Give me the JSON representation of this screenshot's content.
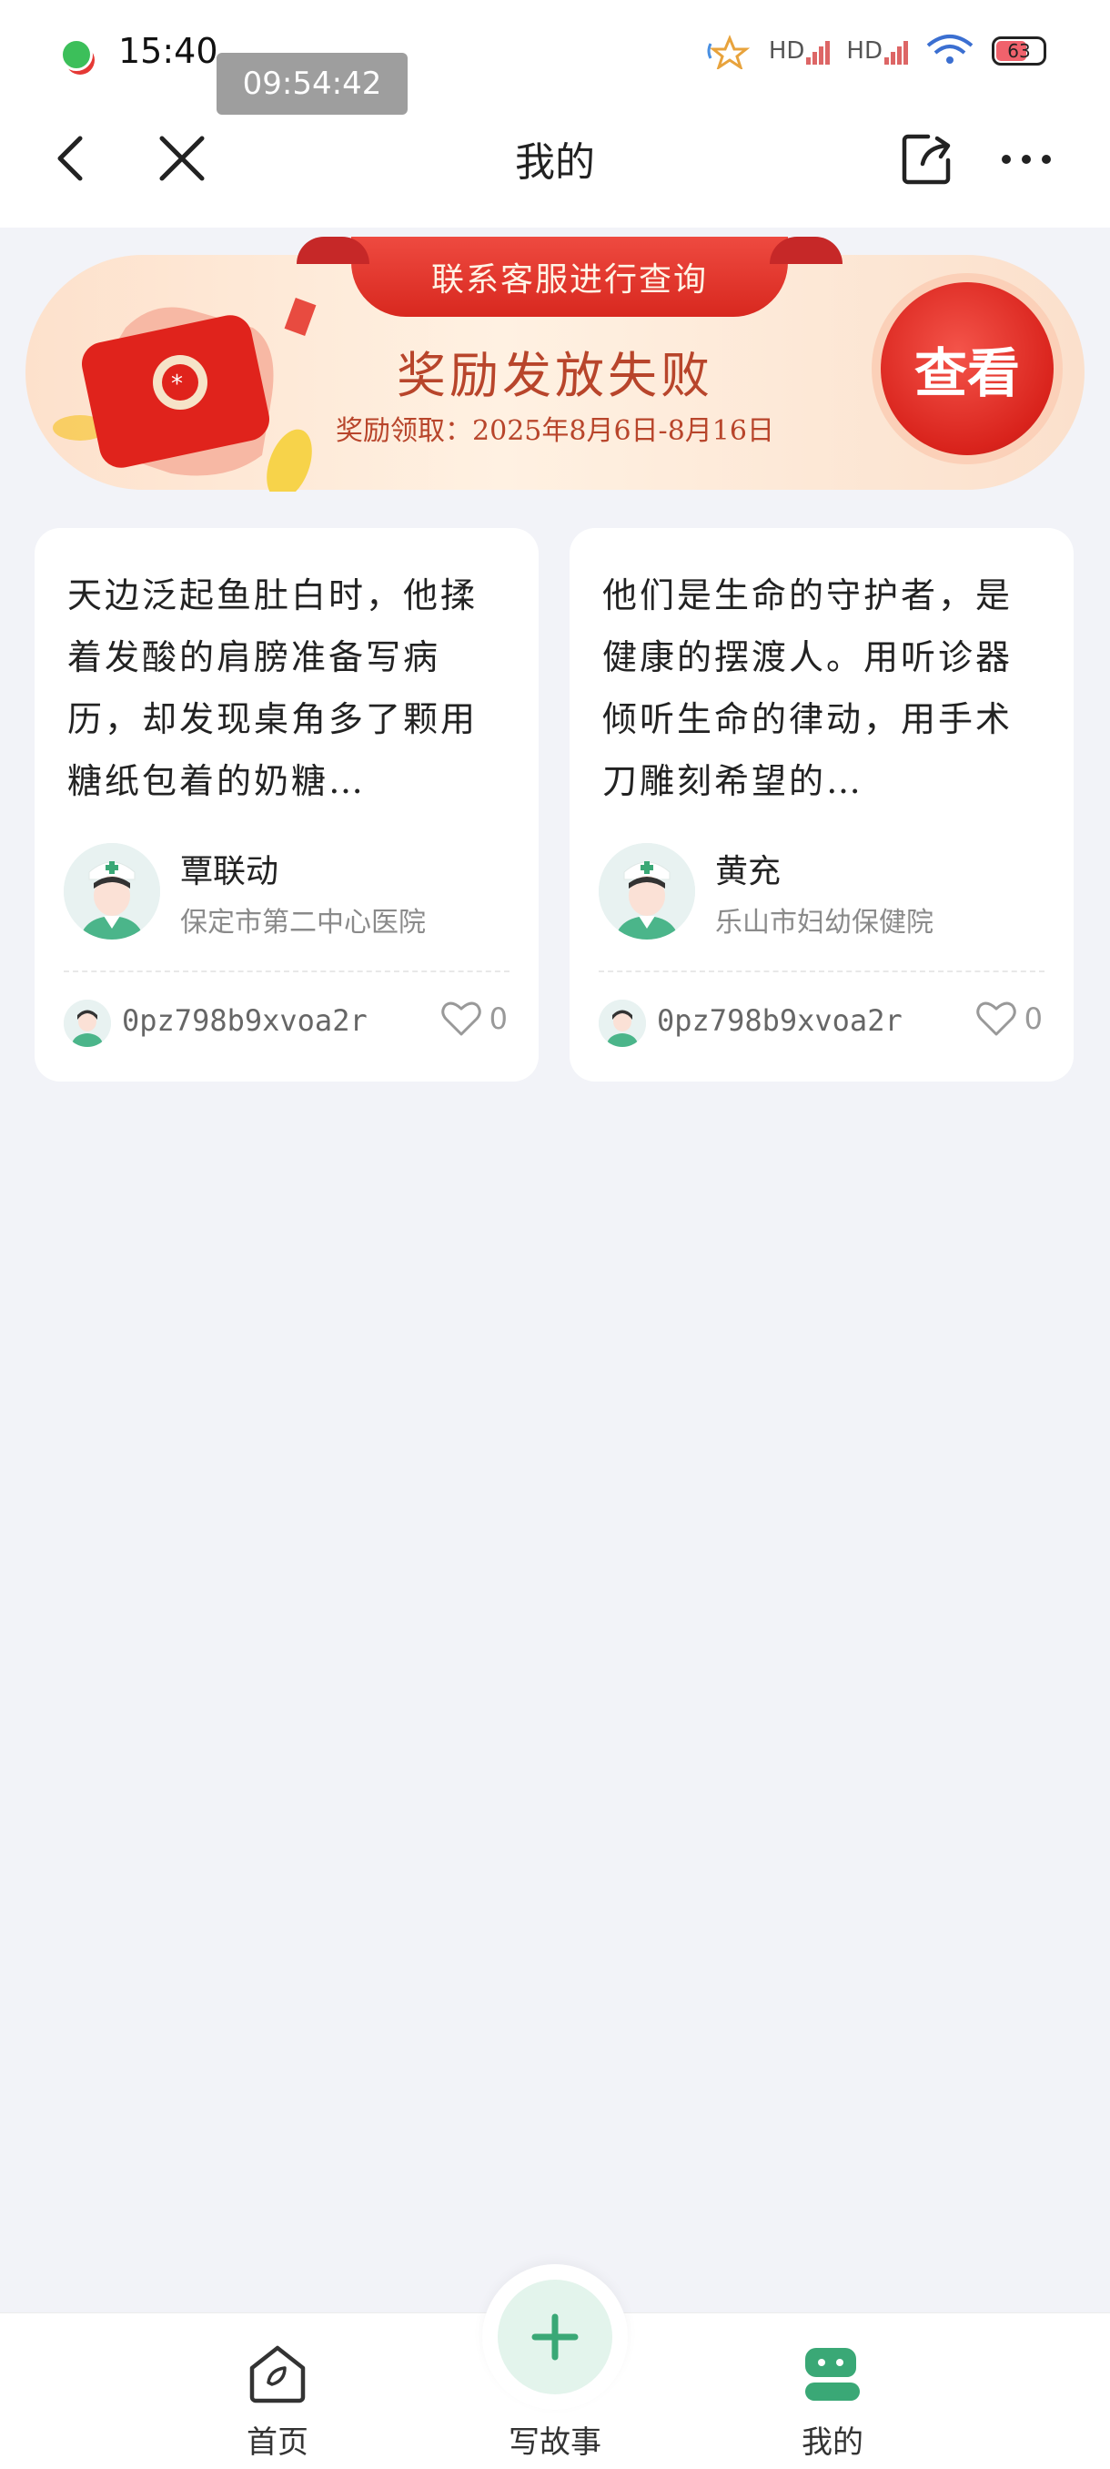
{
  "status_bar": {
    "time": "15:40",
    "overlay_clock": "09:54:42",
    "battery": "63",
    "signal_label_1": "HD",
    "signal_label_2": "HD"
  },
  "header": {
    "title": "我的",
    "icons": [
      "back-icon",
      "close-icon",
      "share-icon",
      "more-icon"
    ]
  },
  "banner": {
    "ribbon": "联系客服进行查询",
    "title": "奖励发放失败",
    "subtitle": "奖励领取：2025年8月6日-8月16日",
    "button": "查看"
  },
  "cards": [
    {
      "text": "天边泛起鱼肚白时，他揉着发酸的肩膀准备写病历，却发现桌角多了颗用糖纸包着的奶糖…",
      "doctor_name": "覃联动",
      "hospital": "保定市第二中心医院",
      "username": "0pz798b9xvoa2r",
      "likes": "0"
    },
    {
      "text": "他们是生命的守护者，是健康的摆渡人。用听诊器倾听生命的律动，用手术刀雕刻希望的…",
      "doctor_name": "黄充",
      "hospital": "乐山市妇幼保健院",
      "username": "0pz798b9xvoa2r",
      "likes": "0"
    }
  ],
  "tabbar": {
    "home": "首页",
    "write": "写故事",
    "me": "我的"
  },
  "colors": {
    "accent_green": "#3aa876",
    "banner_red": "#d9231c",
    "background": "#f2f3f8"
  }
}
